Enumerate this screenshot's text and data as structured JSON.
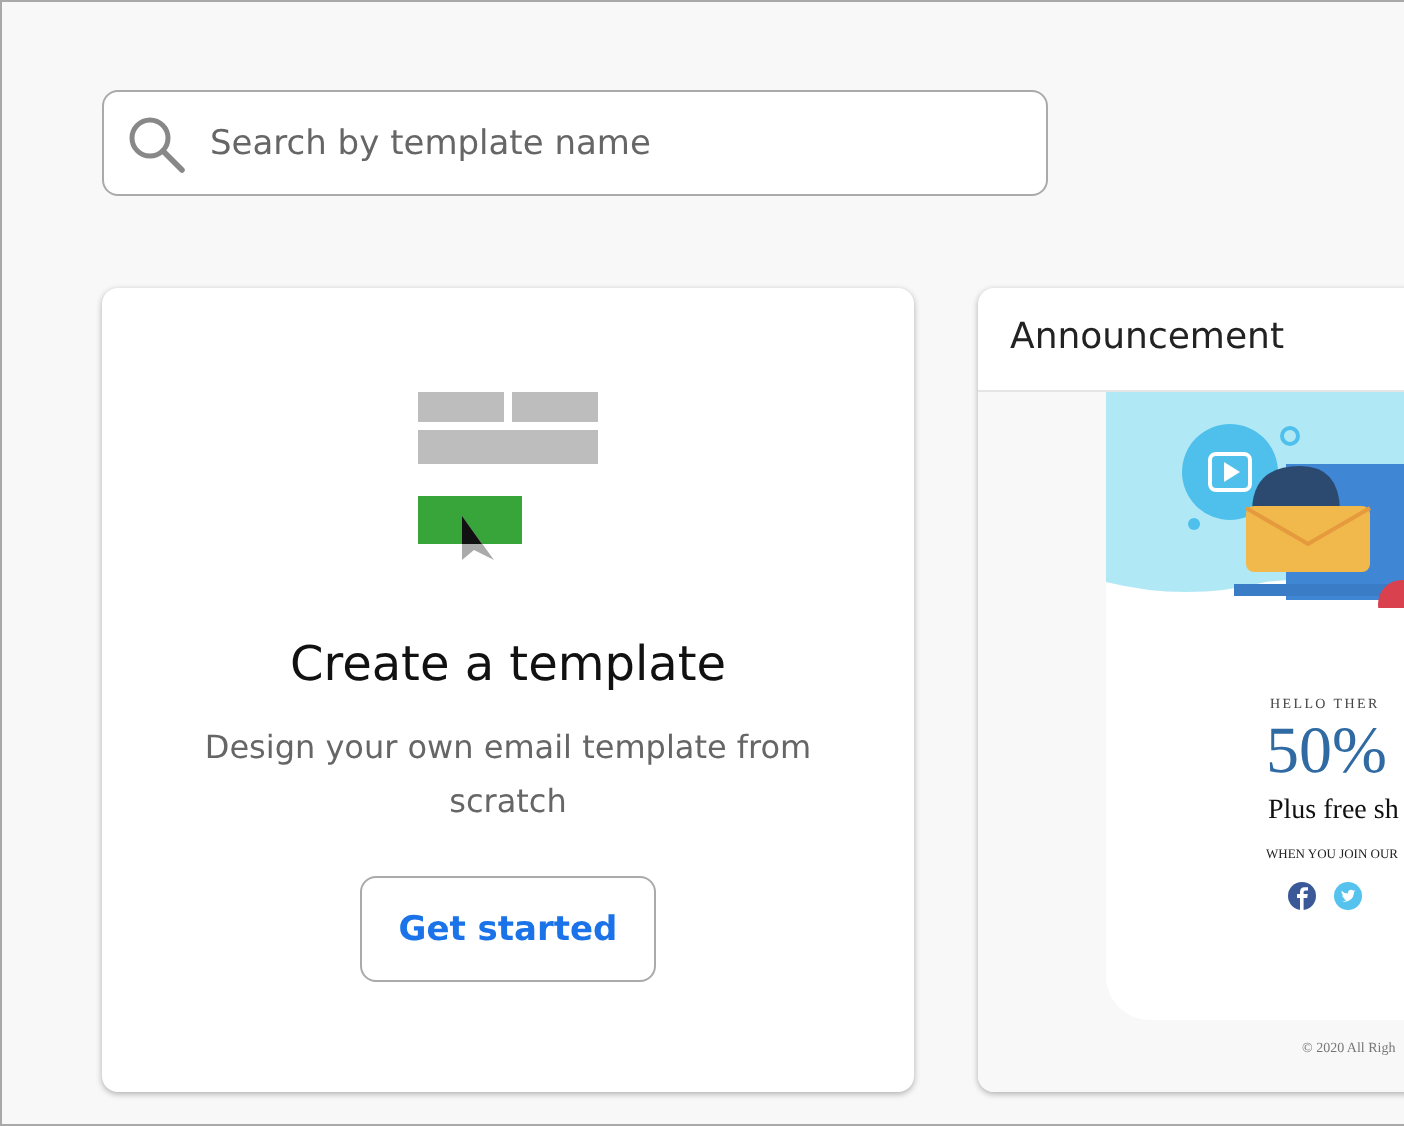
{
  "search": {
    "placeholder": "Search by template name"
  },
  "create_card": {
    "title": "Create a template",
    "description": "Design your own email template from scratch",
    "button": "Get started"
  },
  "template_card": {
    "title": "Announcement",
    "preview": {
      "kind": "picture",
      "greeting": "HELLO THER",
      "headline": "50%",
      "subheadline": "Plus free sh",
      "note": "WHEN YOU JOIN OUR",
      "footer": "© 2020 All Righ"
    }
  }
}
